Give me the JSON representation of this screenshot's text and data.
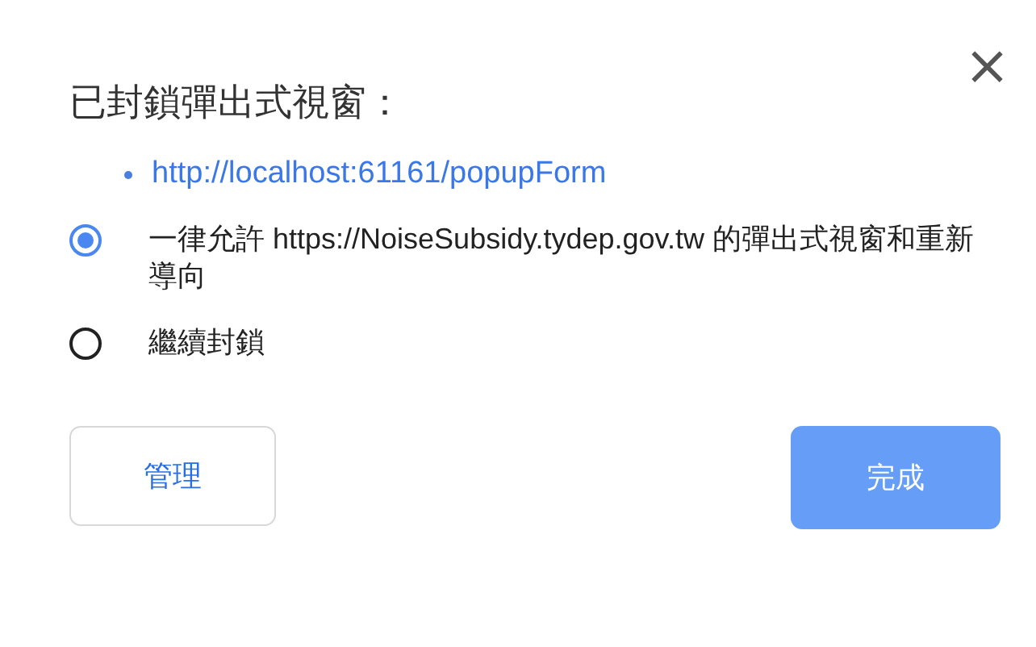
{
  "dialog": {
    "title": "已封鎖彈出式視窗：",
    "close": "×",
    "blocked_links": [
      "http://localhost:61161/popupForm"
    ],
    "options": [
      {
        "label": "一律允許 https://NoiseSubsidy.tydep.gov.tw 的彈出式視窗和重新導向",
        "selected": true
      },
      {
        "label": "繼續封鎖",
        "selected": false
      }
    ],
    "buttons": [
      {
        "label": "管理",
        "kind": "secondary"
      },
      {
        "label": "完成",
        "kind": "primary"
      }
    ]
  }
}
